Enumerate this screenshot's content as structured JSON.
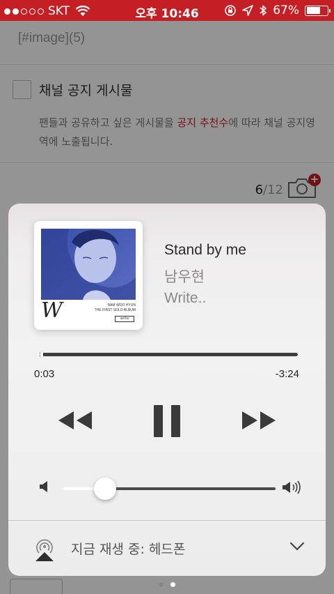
{
  "status_bar": {
    "carrier": "SKT",
    "time": "오후 10:46",
    "battery_text": "67%",
    "battery_level": 0.67,
    "signal_bars": 2
  },
  "background": {
    "image_tag": "[#image](5)",
    "notice_title": "채널 공지 게시물",
    "notice_desc_before": "팬들과 공유하고 싶은 게시물을 ",
    "notice_desc_highlight": "공지 추천수",
    "notice_desc_after": "에 따라 채널 공지영역에 노출됩니다.",
    "counter_current": "6",
    "counter_total": "/12"
  },
  "now_playing": {
    "title": "Stand by me",
    "artist": "남우현",
    "album": "Write..",
    "elapsed": "0:03",
    "remaining": "-3:24",
    "progress": 0.015,
    "volume": 0.2,
    "artwork": {
      "letter": "W",
      "small_text_1": "NAM WOO HYUN",
      "small_text_2": "THE FIRST SOLO ALBUM",
      "box_text": "write"
    }
  },
  "route": {
    "label": "지금 재생 중: 헤드폰"
  },
  "page_indicator": {
    "count": 2,
    "active": 1
  },
  "colors": {
    "accent_red": "#c41f24",
    "panel_bg": "#f2f2f2",
    "text_dark": "#2b2b2b",
    "text_gray": "#8a8a8a"
  }
}
